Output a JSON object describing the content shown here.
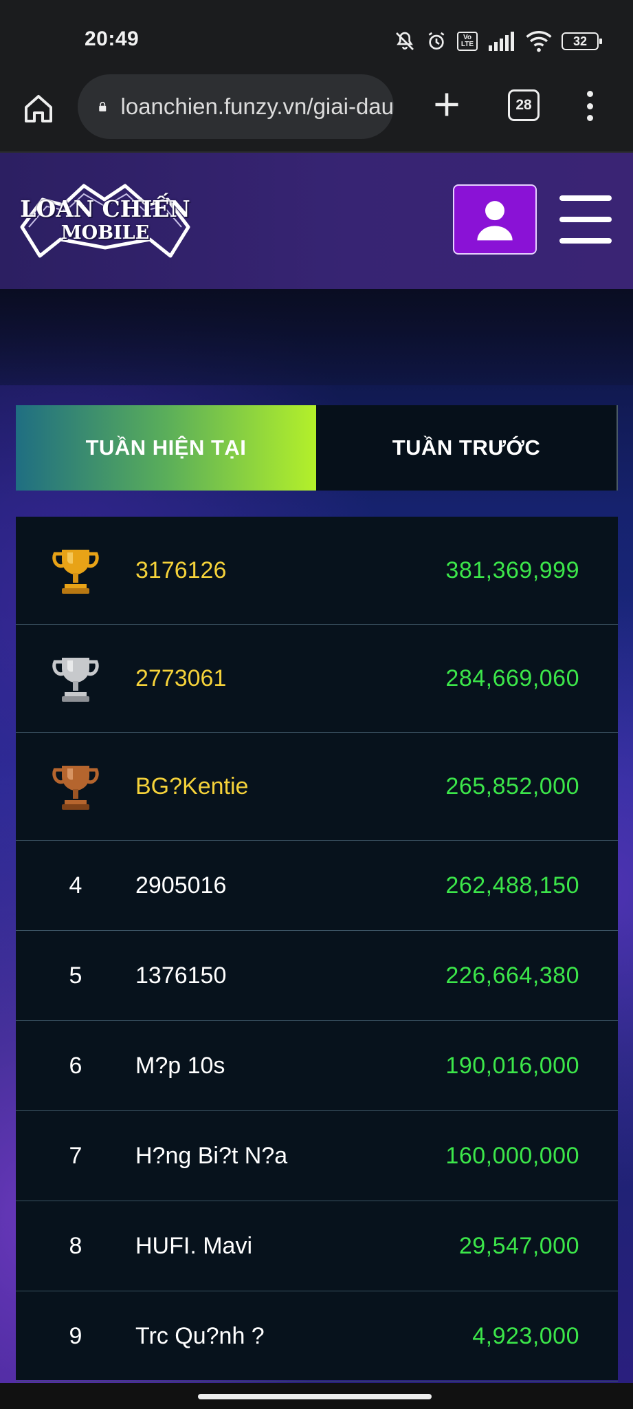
{
  "status_bar": {
    "time": "20:49",
    "battery": "32",
    "network_badge": "Vo LTE"
  },
  "browser": {
    "url": "loanchien.funzy.vn/giai-dau",
    "tab_count": "28"
  },
  "site": {
    "logo_line1": "LOAN CHIẾN",
    "logo_line2": "MOBILE",
    "brand_color": "#8a12d6"
  },
  "tabs": [
    {
      "label": "TUẦN HIỆN TẠI",
      "active": true
    },
    {
      "label": "TUẦN TRƯỚC",
      "active": false
    }
  ],
  "leaderboard": [
    {
      "rank": "1",
      "icon": "gold-trophy-icon",
      "name": "3176126",
      "score": "381,369,999"
    },
    {
      "rank": "2",
      "icon": "silver-trophy-icon",
      "name": "2773061",
      "score": "284,669,060"
    },
    {
      "rank": "3",
      "icon": "bronze-trophy-icon",
      "name": "BG?Kentie",
      "score": "265,852,000"
    },
    {
      "rank": "4",
      "name": "2905016",
      "score": "262,488,150"
    },
    {
      "rank": "5",
      "name": "1376150",
      "score": "226,664,380"
    },
    {
      "rank": "6",
      "name": "M?p 10s",
      "score": "190,016,000"
    },
    {
      "rank": "7",
      "name": "H?ng Bi?t N?a",
      "score": "160,000,000"
    },
    {
      "rank": "8",
      "name": "HUFI. Mavi",
      "score": "29,547,000"
    },
    {
      "rank": "9",
      "name": "Trc Qu?nh ?",
      "score": "4,923,000"
    }
  ]
}
